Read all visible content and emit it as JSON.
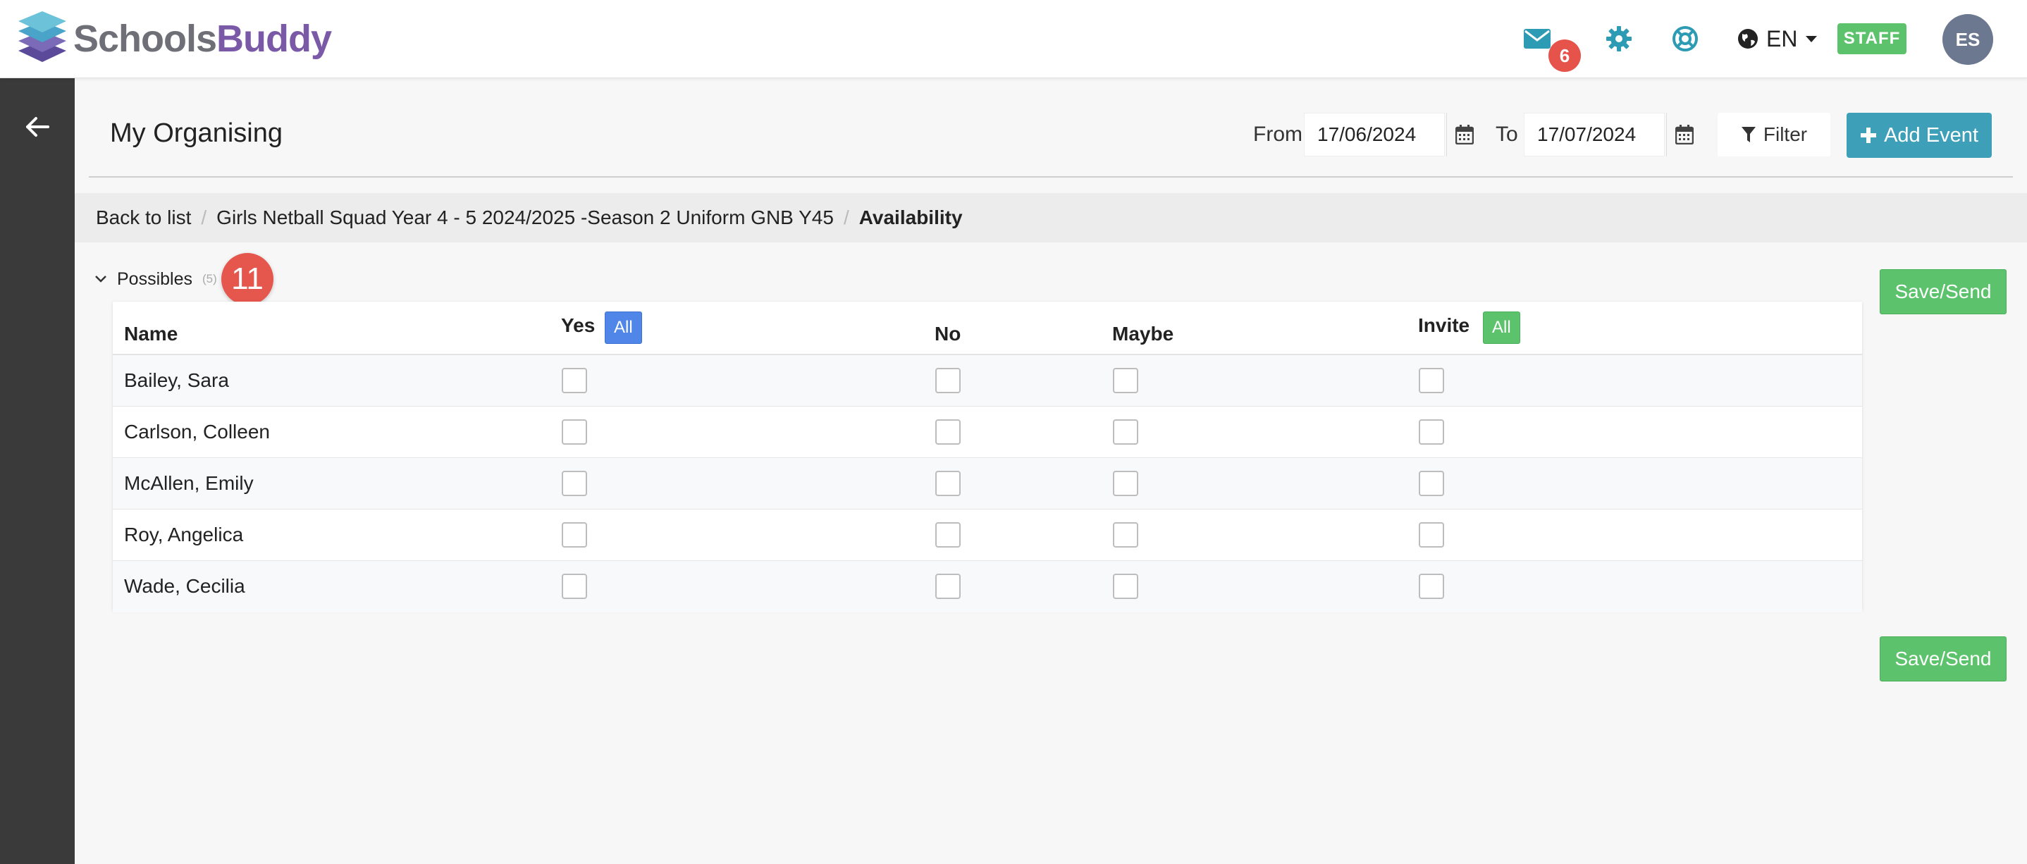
{
  "app": {
    "brand_part1": "Schools",
    "brand_part2": "Buddy"
  },
  "header": {
    "mail_count": "6",
    "language": "EN",
    "role_badge": "STAFF",
    "avatar_initials": "ES"
  },
  "page": {
    "title": "My Organising",
    "from_label": "From",
    "from_date": "17/06/2024",
    "to_label": "To",
    "to_date": "17/07/2024",
    "filter_label": "Filter",
    "add_event_label": "Add Event"
  },
  "breadcrumb": {
    "back": "Back to list",
    "event": "Girls Netball Squad Year 4 - 5 2024/2025 -Season 2 Uniform GNB Y45",
    "current": "Availability"
  },
  "section": {
    "title": "Possibles",
    "count": "(5)",
    "step_badge": "11",
    "save_label": "Save/Send"
  },
  "table": {
    "columns": {
      "name": "Name",
      "yes": "Yes",
      "no": "No",
      "maybe": "Maybe",
      "invite": "Invite",
      "all": "All"
    },
    "rows": [
      {
        "name": "Bailey, Sara",
        "yes": false,
        "no": false,
        "maybe": false,
        "invite": false
      },
      {
        "name": "Carlson, Colleen",
        "yes": false,
        "no": false,
        "maybe": false,
        "invite": false
      },
      {
        "name": "McAllen, Emily",
        "yes": false,
        "no": false,
        "maybe": false,
        "invite": false
      },
      {
        "name": "Roy, Angelica",
        "yes": false,
        "no": false,
        "maybe": false,
        "invite": false
      },
      {
        "name": "Wade, Cecilia",
        "yes": false,
        "no": false,
        "maybe": false,
        "invite": false
      }
    ]
  },
  "colors": {
    "accent": "#3d9fb8",
    "success": "#5cc26c",
    "primary": "#4f86e8",
    "danger": "#e5534b",
    "sidebar": "#3a3a3a"
  },
  "icons": {
    "mail": "envelope-icon",
    "settings": "gear-icon",
    "help": "lifebuoy-icon",
    "language": "globe-icon",
    "back": "arrow-left-icon",
    "calendar": "calendar-icon",
    "filter": "filter-icon",
    "add": "plus-icon",
    "collapse": "chevron-down-icon"
  }
}
